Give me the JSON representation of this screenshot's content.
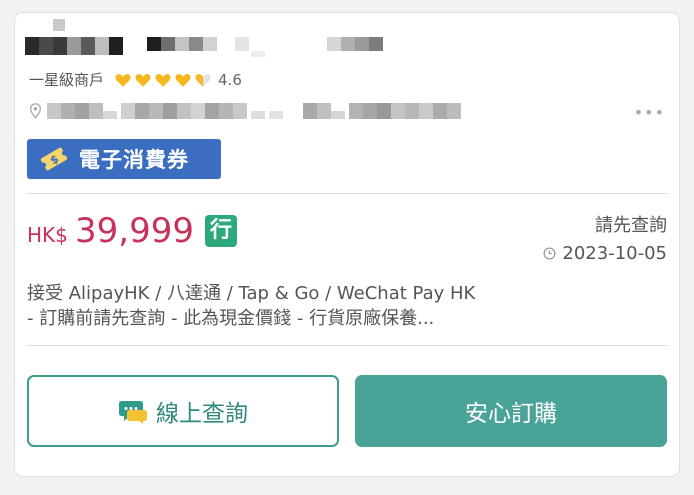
{
  "shop": {
    "merchant_level": "一星級商戶",
    "rating": "4.6",
    "rating_value": 4.6,
    "rating_max": 5,
    "more_icon": "more-horizontal-icon"
  },
  "coupon": {
    "label": "電子消費券",
    "color": "#3b6ec0"
  },
  "price": {
    "currency": "HK$",
    "amount": "39,999",
    "badge": "行",
    "status": "請先查詢",
    "date": "2023-10-05"
  },
  "description": {
    "line1": "接受 AlipayHK / 八達通 / Tap & Go / WeChat Pay HK",
    "line2": "- 訂購前請先查詢 - 此為現金價錢 - 行貨原廠保養..."
  },
  "actions": {
    "inquire_label": "線上查詢",
    "order_label": "安心訂購"
  },
  "colors": {
    "price": "#c8325a",
    "badge": "#2ca87a",
    "primary": "#4aa397",
    "heart": "#f5b820"
  }
}
